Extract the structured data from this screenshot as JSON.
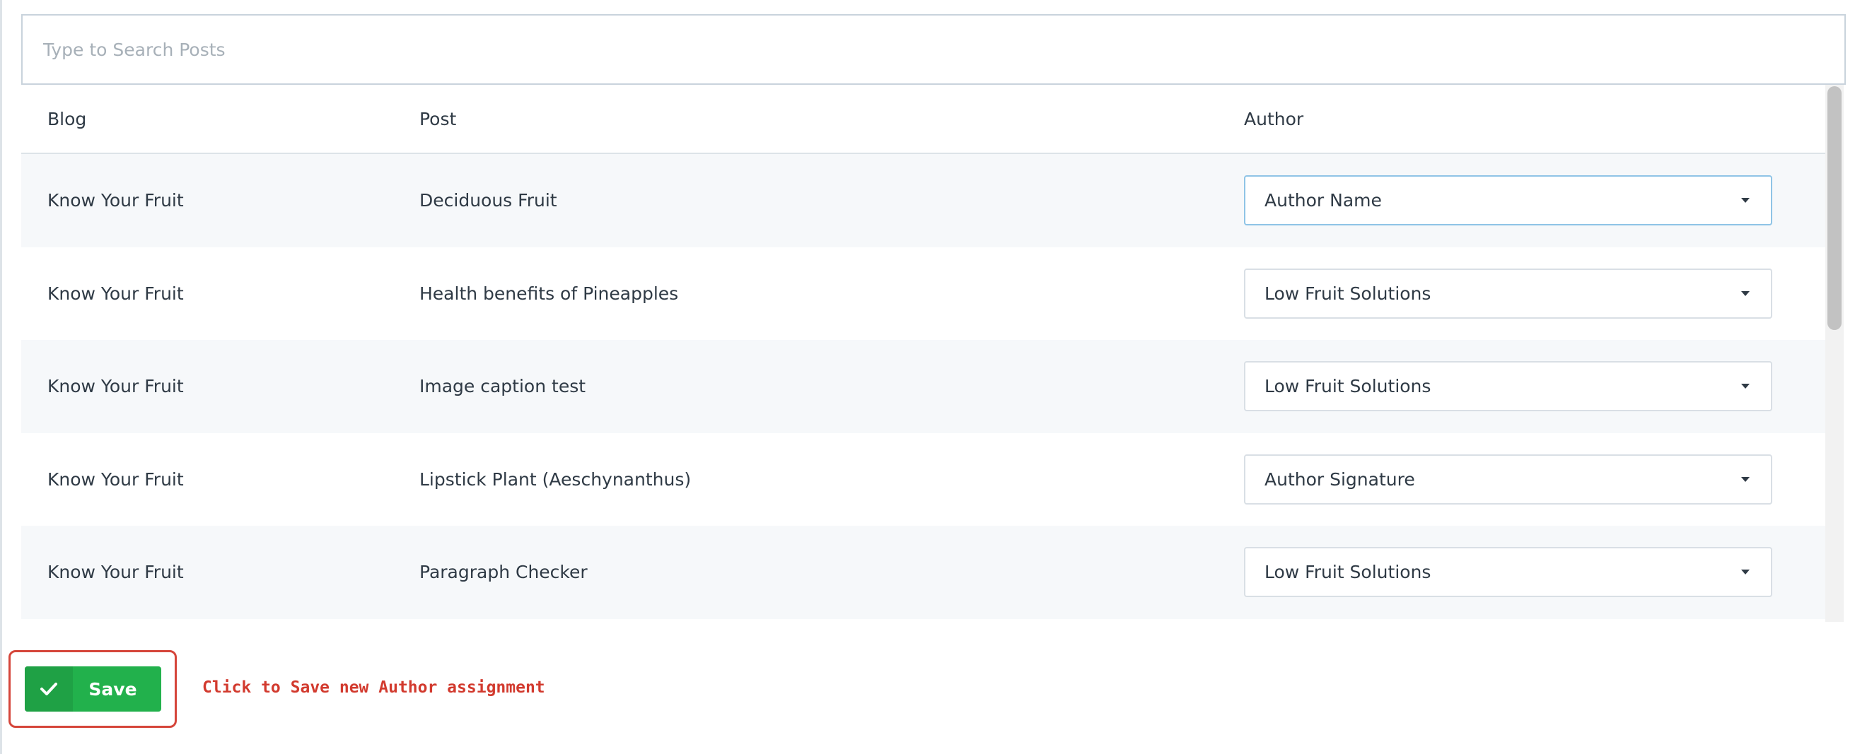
{
  "search": {
    "placeholder": "Type to Search Posts",
    "value": ""
  },
  "table": {
    "columns": [
      "Blog",
      "Post",
      "Author"
    ],
    "rows": [
      {
        "blog": "Know Your Fruit",
        "post": "Deciduous Fruit",
        "author": "Author Name"
      },
      {
        "blog": "Know Your Fruit",
        "post": "Health benefits of Pineapples",
        "author": "Low Fruit Solutions"
      },
      {
        "blog": "Know Your Fruit",
        "post": "Image caption test",
        "author": "Low Fruit Solutions"
      },
      {
        "blog": "Know Your Fruit",
        "post": "Lipstick Plant (Aeschynanthus)",
        "author": "Author Signature"
      },
      {
        "blog": "Know Your Fruit",
        "post": "Paragraph Checker",
        "author": "Low Fruit Solutions"
      }
    ]
  },
  "save_button": {
    "label": "Save",
    "icon": "check-icon",
    "color": "#22b14c"
  },
  "annotation": {
    "text": "Click to Save new Author assignment",
    "color": "#d23a2e"
  }
}
